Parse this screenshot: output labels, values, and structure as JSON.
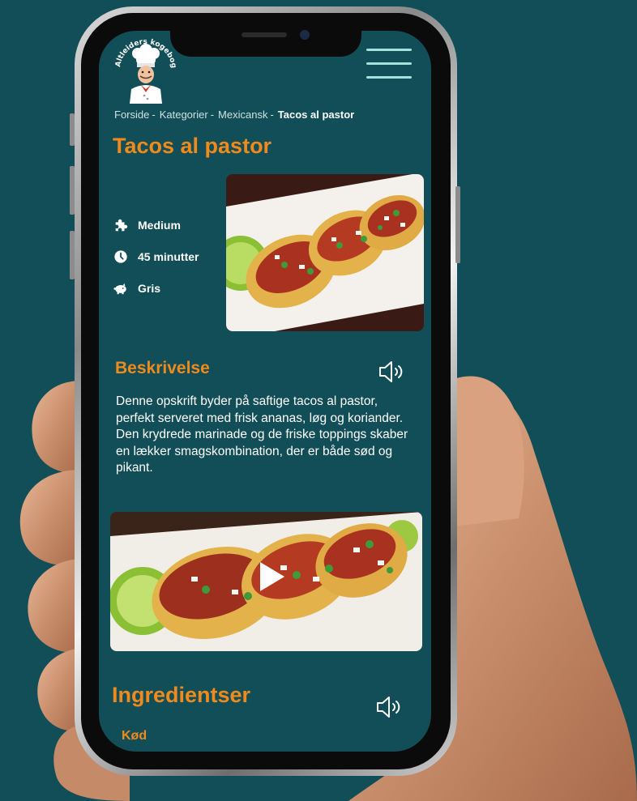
{
  "app": {
    "logo_text": "Altleiders kogebog"
  },
  "breadcrumb": {
    "items": [
      "Forside",
      "Kategorier",
      "Mexicansk"
    ],
    "separator": "-",
    "current": "Tacos al pastor"
  },
  "recipe": {
    "title": "Tacos al pastor",
    "facts": [
      {
        "icon": "puzzle-icon",
        "label": "Medium"
      },
      {
        "icon": "clock-icon",
        "label": "45 minutter"
      },
      {
        "icon": "piggy-icon",
        "label": "Gris"
      }
    ],
    "description_heading": "Beskrivelse",
    "description": "Denne opskrift byder på saftige tacos al pastor, perfekt serveret med frisk ananas, løg og koriander. Den krydrede marinade og de friske toppings skaber en lækker smagskombination, der er både sød og pikant.",
    "ingredients_heading": "Ingredientser",
    "ingredients_first_group": "Kød"
  },
  "colors": {
    "background": "#124e57",
    "accent": "#f08a1c",
    "menu": "#9fe3da",
    "text": "#ffffff"
  },
  "icons": {
    "menu": "hamburger-menu-icon",
    "audio": "speaker-icon",
    "play": "play-icon"
  }
}
